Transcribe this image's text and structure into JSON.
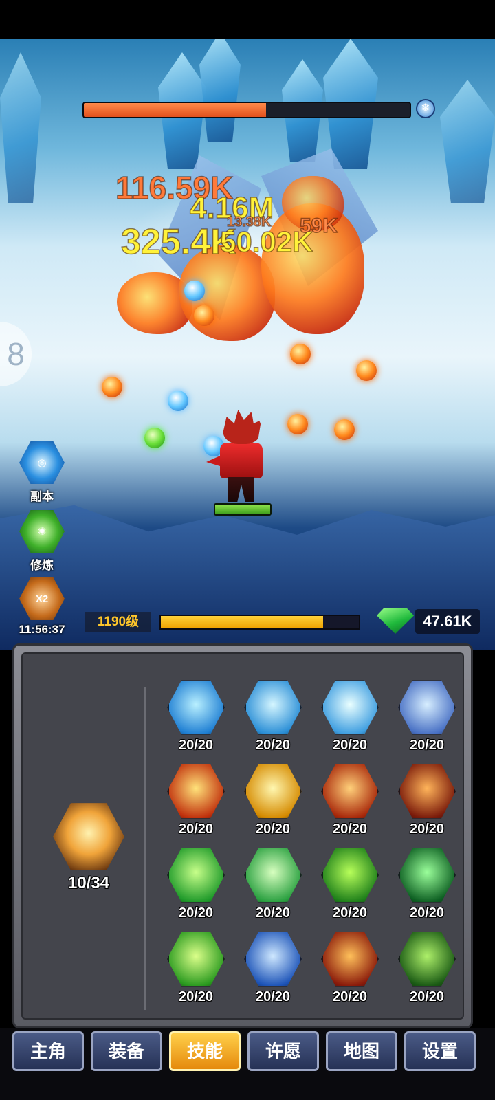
{
  "battle": {
    "boss_hp_fraction": 0.56,
    "boss_element_icon": "snowflake-icon",
    "damage_numbers": [
      {
        "text": "116.59K",
        "color": "#ff7a3a"
      },
      {
        "text": "4.16M",
        "color": "#fff23a"
      },
      {
        "text": "13.38K",
        "color": "#ff9a5a"
      },
      {
        "text": "59K",
        "color": "#ff8a4a"
      },
      {
        "text": "325.4K",
        "color": "#fff23a"
      },
      {
        "text": "50.02K",
        "color": "#fff23a"
      }
    ],
    "hero_hp_fraction": 1.0
  },
  "side_buttons": [
    {
      "label": "副本",
      "icon": "vortex-icon"
    },
    {
      "label": "修炼",
      "icon": "cultivation-icon"
    },
    {
      "label": "11:56:37",
      "icon": "double-reward-icon",
      "badge": "X2"
    }
  ],
  "status": {
    "level": "1190级",
    "exp_fraction": 0.82,
    "gems": "47.61K"
  },
  "skills_panel": {
    "main_skill": {
      "count": "10/34",
      "icon": "shadow-hero-icon"
    },
    "skills": [
      {
        "count": "20/20",
        "icon": "ice-spikes-icon",
        "colors": [
          "#b9f0ff",
          "#1f7fd3"
        ]
      },
      {
        "count": "20/20",
        "icon": "ice-tornado-icon",
        "colors": [
          "#d5f6ff",
          "#2a8ed6"
        ]
      },
      {
        "count": "20/20",
        "icon": "ice-wave-icon",
        "colors": [
          "#eaffff",
          "#3d9de0"
        ]
      },
      {
        "count": "20/20",
        "icon": "ice-shards-icon",
        "colors": [
          "#d7eeff",
          "#4870c4"
        ]
      },
      {
        "count": "20/20",
        "icon": "fire-pillars-icon",
        "colors": [
          "#ffe27a",
          "#c0300c"
        ]
      },
      {
        "count": "20/20",
        "icon": "fire-sun-icon",
        "colors": [
          "#fff7b0",
          "#d58a00"
        ]
      },
      {
        "count": "20/20",
        "icon": "fire-blast-icon",
        "colors": [
          "#ffd07a",
          "#a8280a"
        ]
      },
      {
        "count": "20/20",
        "icon": "fire-ring-icon",
        "colors": [
          "#ffb45a",
          "#7a1a0a"
        ]
      },
      {
        "count": "20/20",
        "icon": "leaf-slash-icon",
        "colors": [
          "#c8ff8a",
          "#1f9a2a"
        ]
      },
      {
        "count": "20/20",
        "icon": "wind-lightning-icon",
        "colors": [
          "#d8ffc0",
          "#2aa040"
        ]
      },
      {
        "count": "20/20",
        "icon": "green-whirl-icon",
        "colors": [
          "#b8ff5a",
          "#1e7f1a"
        ]
      },
      {
        "count": "20/20",
        "icon": "nature-spirit-icon",
        "colors": [
          "#9bff9b",
          "#0d5f22"
        ]
      },
      {
        "count": "20/20",
        "icon": "heart-heal-icon",
        "colors": [
          "#dcff8a",
          "#2a9a1f"
        ]
      },
      {
        "count": "20/20",
        "icon": "water-vortex-icon",
        "colors": [
          "#cfe8ff",
          "#1d54b8"
        ]
      },
      {
        "count": "20/20",
        "icon": "inferno-icon",
        "colors": [
          "#ffc05a",
          "#8a1a0a"
        ]
      },
      {
        "count": "20/20",
        "icon": "thorn-vines-icon",
        "colors": [
          "#aef06a",
          "#1a5a14"
        ]
      }
    ]
  },
  "bottom_nav": {
    "tabs": [
      "主角",
      "装备",
      "技能",
      "许愿",
      "地图",
      "设置"
    ],
    "active": "技能"
  }
}
